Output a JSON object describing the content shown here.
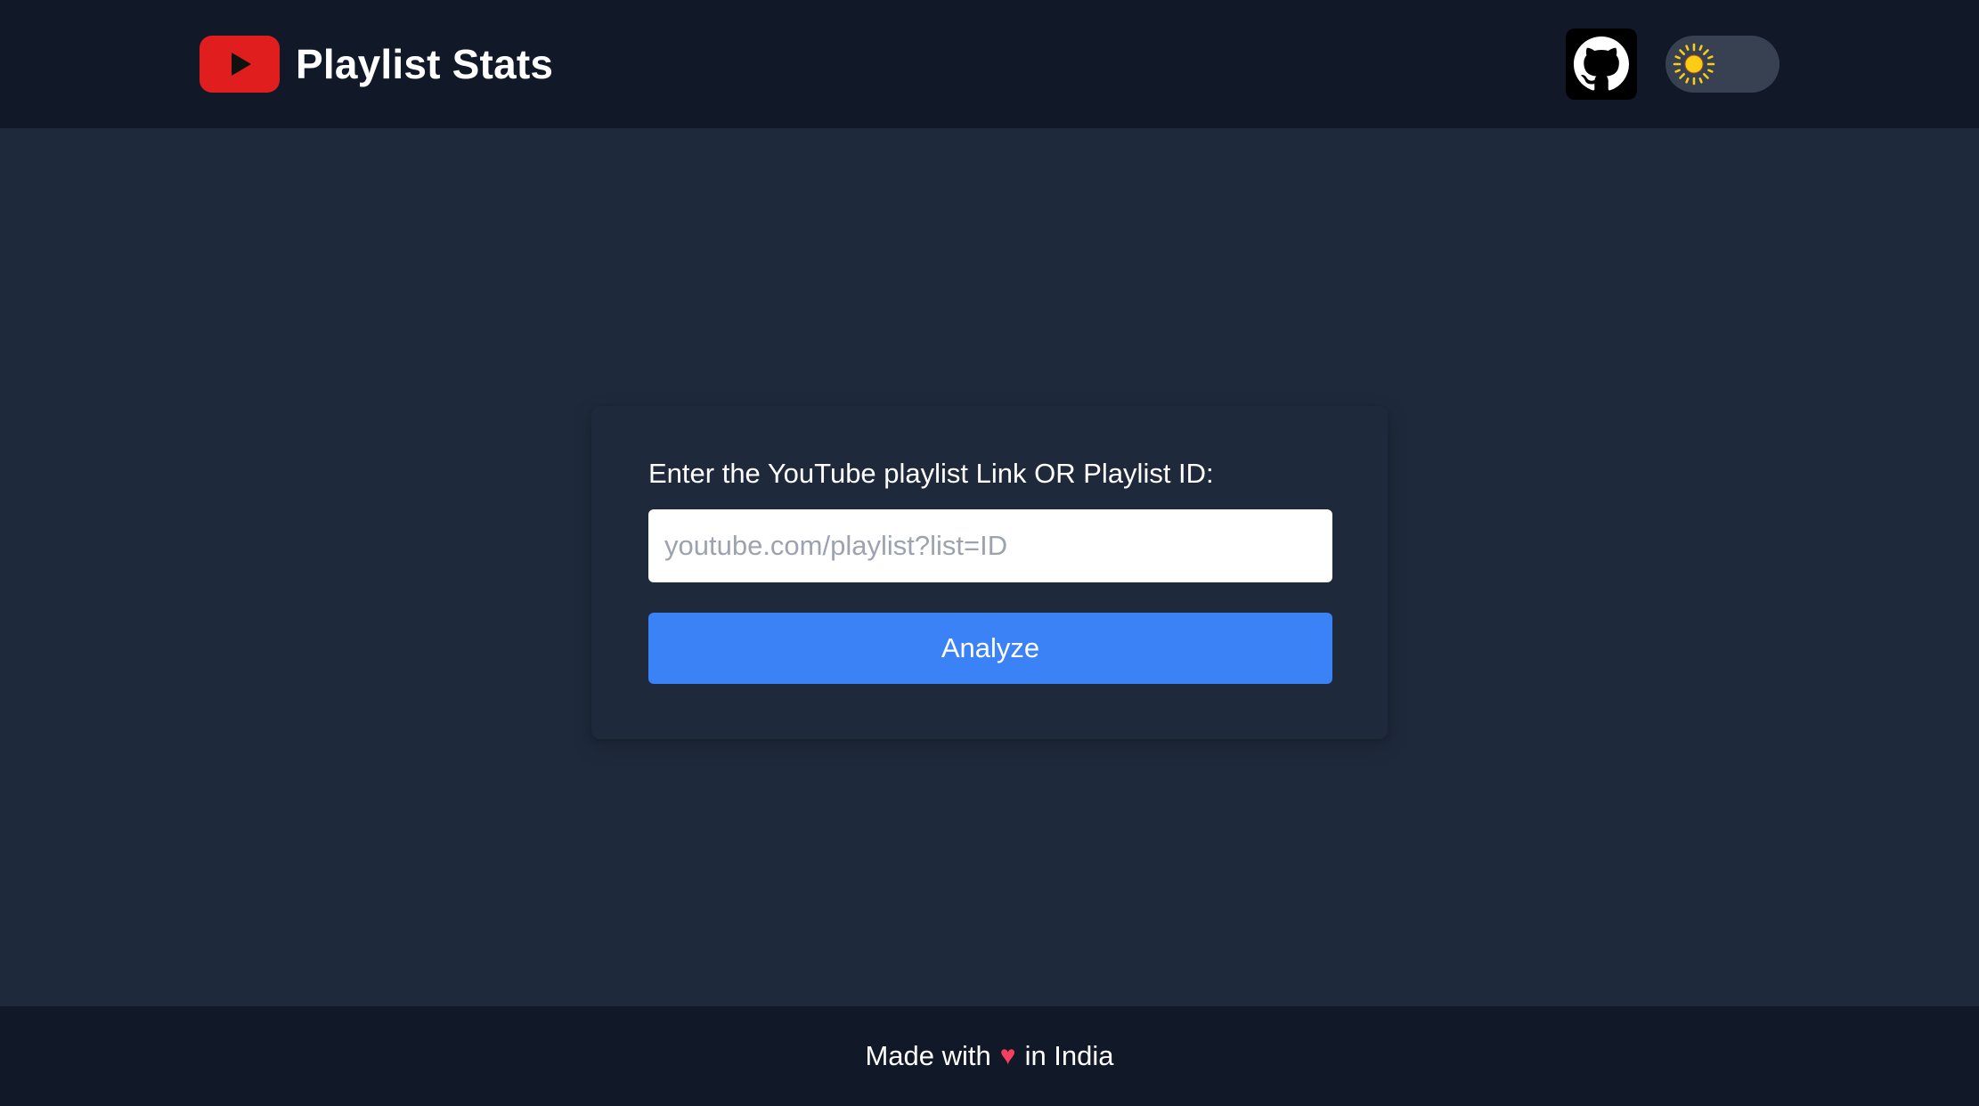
{
  "header": {
    "title": "Playlist Stats",
    "logo_icon": "youtube-logo-icon",
    "github_icon": "github-icon",
    "theme_icon": "sun-icon",
    "logo_color": "#e01e1e"
  },
  "form": {
    "label": "Enter the YouTube playlist Link OR Playlist ID:",
    "input_placeholder": "youtube.com/playlist?list=ID",
    "input_value": "",
    "button_label": "Analyze",
    "button_color": "#3b82f6"
  },
  "footer": {
    "prefix": "Made with",
    "heart": "♥",
    "suffix": "in India",
    "heart_color": "#f43f5e"
  },
  "colors": {
    "header_bg": "#111827",
    "page_bg": "#1e293b",
    "toggle_bg": "#374151",
    "sun": "#facc15"
  }
}
